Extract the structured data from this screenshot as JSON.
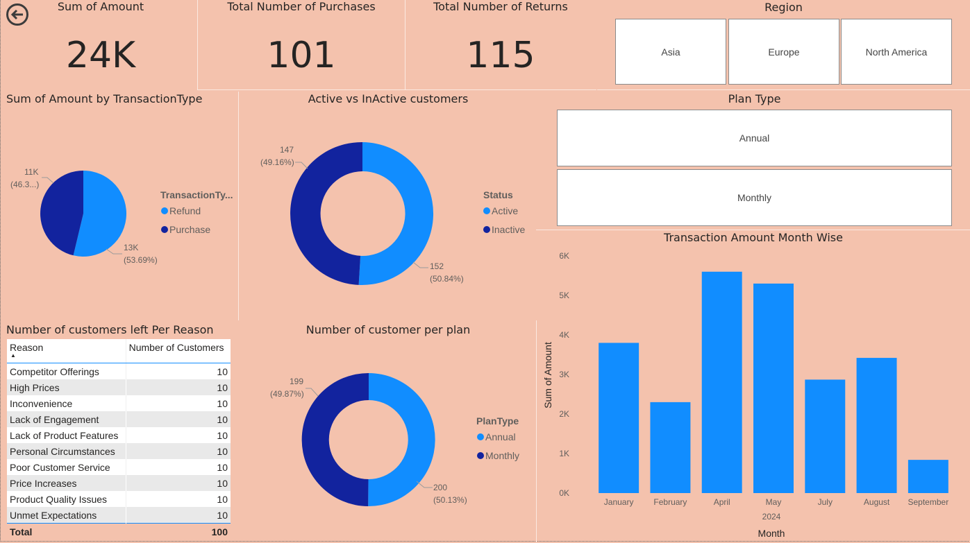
{
  "cards": [
    {
      "title": "Sum of Amount",
      "value": "24K"
    },
    {
      "title": "Total Number of Purchases",
      "value": "101"
    },
    {
      "title": "Total Number of Returns",
      "value": "115"
    }
  ],
  "region_slicer": {
    "title": "Region",
    "options": [
      "Asia",
      "Europe",
      "North America"
    ]
  },
  "plan_slicer": {
    "title": "Plan Type",
    "options": [
      "Annual",
      "Monthly"
    ]
  },
  "colors": {
    "light": "#118dff",
    "dark": "#12239e",
    "background": "#f4c2ad"
  },
  "pie_transaction": {
    "title": "Sum of Amount by TransactionType",
    "legend_title": "TransactionTy...",
    "legend": [
      "Refund",
      "Purchase"
    ],
    "label_refund": [
      "13K",
      "(53.69%)"
    ],
    "label_purchase": [
      "11K",
      "(46.3...)"
    ]
  },
  "donut_status": {
    "title": "Active vs InActive customers",
    "legend_title": "Status",
    "legend": [
      "Active",
      "Inactive"
    ],
    "label_active": [
      "152",
      "(50.84%)"
    ],
    "label_inactive": [
      "147",
      "(49.16%)"
    ]
  },
  "donut_plan": {
    "title": "Number of customer per plan",
    "legend_title": "PlanType",
    "legend": [
      "Annual",
      "Monthly"
    ],
    "label_annual": [
      "200",
      "(50.13%)"
    ],
    "label_monthly": [
      "199",
      "(49.87%)"
    ]
  },
  "reasons_table": {
    "title": "Number of customers left Per Reason",
    "headers": [
      "Reason",
      "Number of Customers"
    ],
    "rows": [
      [
        "Competitor Offerings",
        "10"
      ],
      [
        "High Prices",
        "10"
      ],
      [
        "Inconvenience",
        "10"
      ],
      [
        "Lack of Engagement",
        "10"
      ],
      [
        "Lack of Product Features",
        "10"
      ],
      [
        "Personal Circumstances",
        "10"
      ],
      [
        "Poor Customer Service",
        "10"
      ],
      [
        "Price Increases",
        "10"
      ],
      [
        "Product Quality Issues",
        "10"
      ],
      [
        "Unmet Expectations",
        "10"
      ]
    ],
    "total": [
      "Total",
      "100"
    ]
  },
  "chart_data": [
    {
      "type": "pie",
      "title": "Sum of Amount by TransactionType",
      "legend_title": "TransactionTy...",
      "categories": [
        "Refund",
        "Purchase"
      ],
      "values": [
        13000,
        11000
      ],
      "percent": [
        53.69,
        46.31
      ],
      "legend": "right"
    },
    {
      "type": "pie",
      "title": "Active vs InActive customers",
      "legend_title": "Status",
      "categories": [
        "Active",
        "Inactive"
      ],
      "values": [
        152,
        147
      ],
      "percent": [
        50.84,
        49.16
      ],
      "legend": "right"
    },
    {
      "type": "pie",
      "title": "Number of customer per plan",
      "legend_title": "PlanType",
      "categories": [
        "Annual",
        "Monthly"
      ],
      "values": [
        200,
        199
      ],
      "percent": [
        50.13,
        49.87
      ],
      "legend": "right"
    },
    {
      "type": "bar",
      "title": "Transaction Amount Month Wise",
      "categories": [
        "January",
        "February",
        "April",
        "May",
        "July",
        "August",
        "September"
      ],
      "values": [
        3800,
        2300,
        5600,
        5300,
        2870,
        3420,
        840
      ],
      "xlabel": "Month",
      "xgroup": "2024",
      "ylabel": "Sum of Amount",
      "ylim": [
        0,
        6000
      ],
      "yticks": [
        "0K",
        "1K",
        "2K",
        "3K",
        "4K",
        "5K",
        "6K"
      ],
      "grid": false
    }
  ]
}
